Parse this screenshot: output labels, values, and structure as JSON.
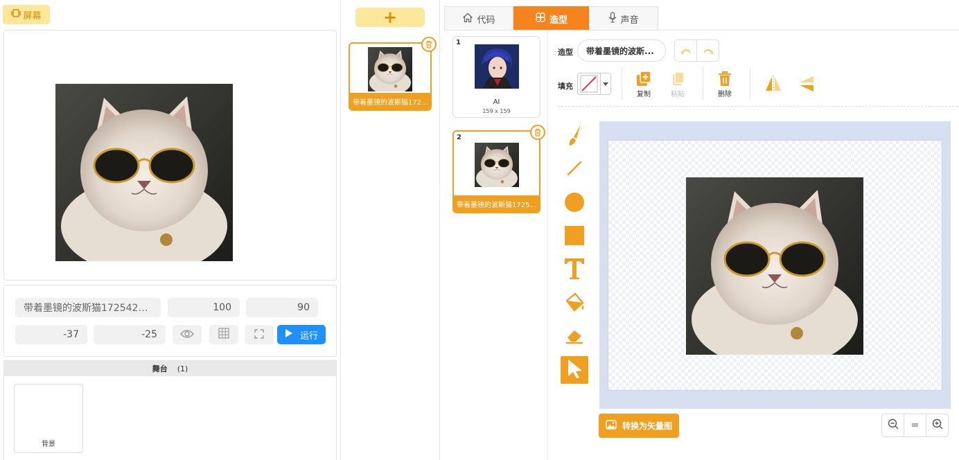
{
  "left_panel": {
    "screen_button_label": "屏幕",
    "props": {
      "sprite_name": "带着墨镜的波斯猫1725429…",
      "size": "100",
      "direction": "90",
      "x": "-37",
      "y": "-25",
      "run_label": "运行"
    },
    "stage": {
      "title": "舞台",
      "count": "(1)",
      "backdrop_label": "背景"
    }
  },
  "sprites_panel": {
    "add_label": "+",
    "sprites": [
      {
        "label": "带着墨镜的波斯猫172..."
      }
    ]
  },
  "tabs": [
    {
      "label": "代码",
      "icon": "home-icon"
    },
    {
      "label": "造型",
      "icon": "costume-icon"
    },
    {
      "label": "声音",
      "icon": "microphone-icon"
    }
  ],
  "costumes": [
    {
      "index": "1",
      "name": "AI",
      "size": "159 x 159"
    },
    {
      "index": "2",
      "label": "带着墨镜的波斯猫1725..."
    }
  ],
  "editor": {
    "costume_label": "造型",
    "costume_name": "带着墨镜的波斯...",
    "fill_label": "填充",
    "copy_label": "复制",
    "paste_label": "粘贴",
    "delete_label": "删除",
    "convert_label": "转换为矢量图",
    "zoom_reset_label": "="
  },
  "colors": {
    "accent": "#f0a020",
    "active_tab": "#f5841f",
    "run_button": "#1e90ff",
    "add_button_bg": "#fde79a",
    "canvas_frame": "#d6e0f0"
  }
}
